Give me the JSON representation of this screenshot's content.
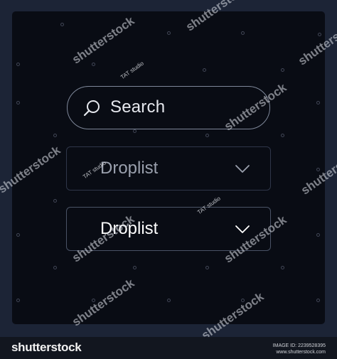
{
  "search": {
    "label": "Search",
    "icon": "search-icon"
  },
  "droplists": [
    {
      "label": "Droplist",
      "icon": "chevron-down-icon"
    },
    {
      "label": "Droplist",
      "icon": "chevron-down-icon"
    }
  ],
  "watermark": {
    "brand": "shutterstock",
    "tag": "TAT studio"
  },
  "footer": {
    "logo": "shutterstock",
    "image_id": "IMAGE ID: 2239528395",
    "site": "www.shutterstock.com"
  },
  "colors": {
    "frame": "#1c2436",
    "panel": "#090c14",
    "search_border": "#7e8799",
    "droplist_border": "#2f3649",
    "text_primary": "#ffffff",
    "text_muted": "#9aa0ad"
  }
}
